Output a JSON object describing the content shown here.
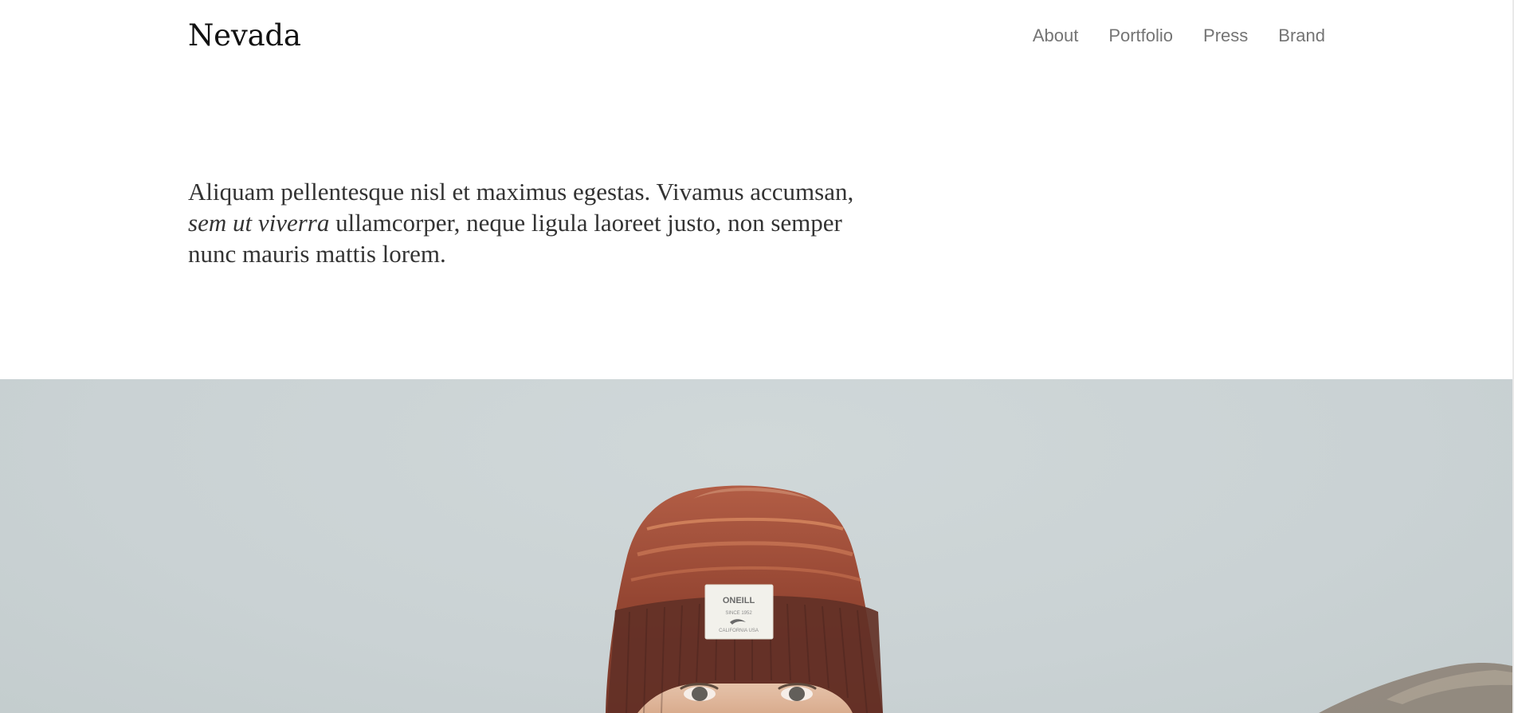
{
  "site": {
    "title": "Nevada"
  },
  "nav": {
    "items": [
      {
        "label": "About"
      },
      {
        "label": "Portfolio"
      },
      {
        "label": "Press"
      },
      {
        "label": "Brand"
      }
    ]
  },
  "intro": {
    "text_before": "Aliquam pellentesque nisl et maximus egestas. Vivamus accumsan, ",
    "text_emphasis": "sem ut viverra",
    "text_after": " ullamcorper, neque ligula laoreet justo, non semper nunc mauris mattis lorem."
  },
  "hero": {
    "beanie_label": {
      "brand": "ONEILL",
      "line1": "SINCE 1952",
      "line2": "CALIFORNIA USA"
    }
  }
}
